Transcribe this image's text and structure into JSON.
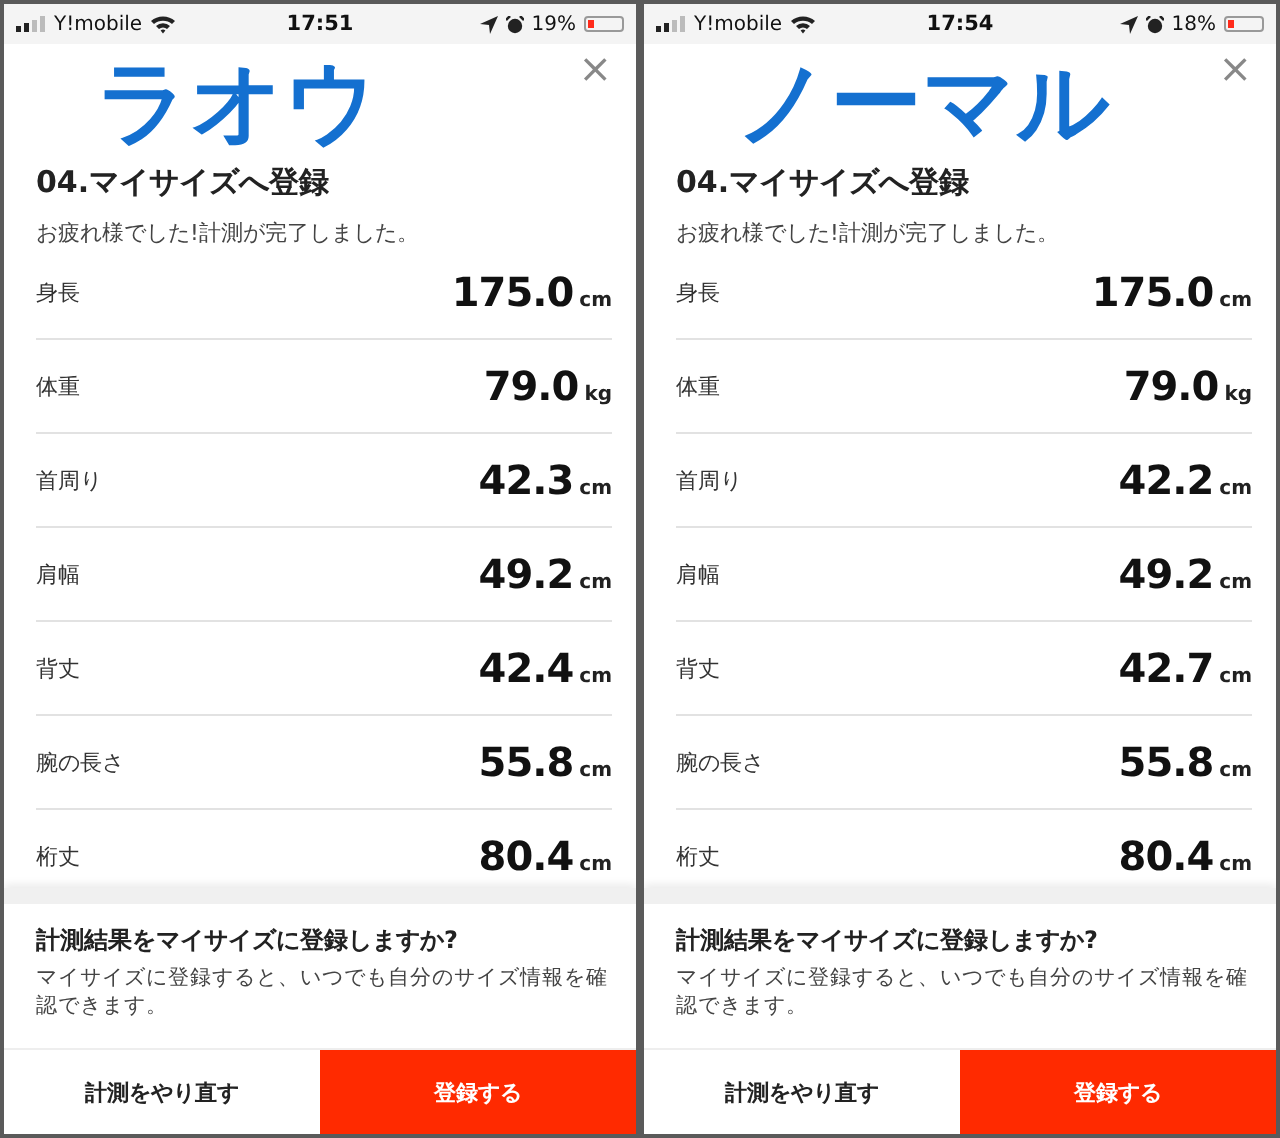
{
  "screens": [
    {
      "status_bar": {
        "carrier": "Y!mobile",
        "time": "17:51",
        "battery_percent": "19%",
        "battery": {
          "level": 0.19
        }
      },
      "annotation": "ラオウ",
      "close": "×",
      "title": "04.マイサイズへ登録",
      "subtitle": "お疲れ様でした!計測が完了しました。",
      "measurements": [
        {
          "label": "身長",
          "value": "175.0",
          "unit": "cm"
        },
        {
          "label": "体重",
          "value": "79.0",
          "unit": "kg"
        },
        {
          "label": "首周り",
          "value": "42.3",
          "unit": "cm"
        },
        {
          "label": "肩幅",
          "value": "49.2",
          "unit": "cm"
        },
        {
          "label": "背丈",
          "value": "42.4",
          "unit": "cm"
        },
        {
          "label": "腕の長さ",
          "value": "55.8",
          "unit": "cm"
        },
        {
          "label": "桁丈",
          "value": "80.4",
          "unit": "cm"
        }
      ],
      "prompt": {
        "question": "計測結果をマイサイズに登録しますか?",
        "description": "マイサイズに登録すると、いつでも自分のサイズ情報を確認できます。"
      },
      "buttons": [
        {
          "label": "計測をやり直す",
          "kind": "secondary"
        },
        {
          "label": "登録する",
          "kind": "primary"
        }
      ]
    },
    {
      "status_bar": {
        "carrier": "Y!mobile",
        "time": "17:54",
        "battery_percent": "18%",
        "battery": {
          "level": 0.18
        }
      },
      "annotation": "ノーマル",
      "close": "×",
      "title": "04.マイサイズへ登録",
      "subtitle": "お疲れ様でした!計測が完了しました。",
      "measurements": [
        {
          "label": "身長",
          "value": "175.0",
          "unit": "cm"
        },
        {
          "label": "体重",
          "value": "79.0",
          "unit": "kg"
        },
        {
          "label": "首周り",
          "value": "42.2",
          "unit": "cm"
        },
        {
          "label": "肩幅",
          "value": "49.2",
          "unit": "cm"
        },
        {
          "label": "背丈",
          "value": "42.7",
          "unit": "cm"
        },
        {
          "label": "腕の長さ",
          "value": "55.8",
          "unit": "cm"
        },
        {
          "label": "桁丈",
          "value": "80.4",
          "unit": "cm"
        }
      ],
      "prompt": {
        "question": "計測結果をマイサイズに登録しますか?",
        "description": "マイサイズに登録すると、いつでも自分のサイズ情報を確認できます。"
      },
      "buttons": [
        {
          "label": "計測をやり直す",
          "kind": "secondary"
        },
        {
          "label": "登録する",
          "kind": "primary"
        }
      ]
    }
  ]
}
